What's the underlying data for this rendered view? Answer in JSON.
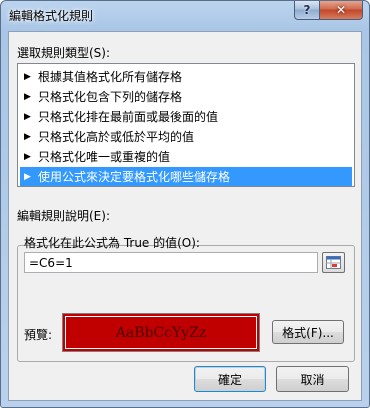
{
  "window": {
    "title": "編輯格式化規則",
    "help_label": "?",
    "close_label": "✕"
  },
  "rule_type": {
    "label": "選取規則類型(S):",
    "items": [
      {
        "label": "根據其值格式化所有儲存格",
        "selected": false
      },
      {
        "label": "只格式化包含下列的儲存格",
        "selected": false
      },
      {
        "label": "只格式化排在最前面或最後面的值",
        "selected": false
      },
      {
        "label": "只格式化高於或低於平均的值",
        "selected": false
      },
      {
        "label": "只格式化唯一或重複的值",
        "selected": false
      },
      {
        "label": "使用公式來決定要格式化哪些儲存格",
        "selected": true
      }
    ]
  },
  "edit_rule": {
    "label": "編輯規則說明(E):",
    "formula_label": "格式化在此公式為 True 的值(O):",
    "formula_value": "=C6=1",
    "preview_label": "預覽:",
    "preview_text": "AaBbCcYyZz",
    "format_button": "格式(F)..."
  },
  "buttons": {
    "ok": "確定",
    "cancel": "取消"
  },
  "colors": {
    "preview_fill": "#c00000",
    "selection": "#3399ff"
  },
  "icons": {
    "collapse": "range-select-icon",
    "arrow": "triangle-right-icon"
  }
}
